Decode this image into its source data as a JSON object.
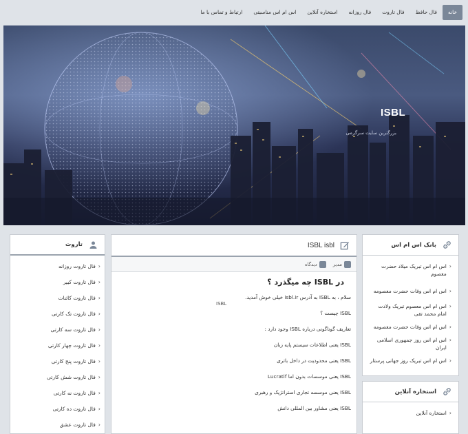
{
  "nav": {
    "items": [
      "خانه",
      "فال حافظ",
      "فال تاروت",
      "فال روزانه",
      "استخاره آنلاین",
      "اس ام اس مناسبتی",
      "ارتباط و تماس با ما"
    ]
  },
  "hero": {
    "title": "ISBL",
    "subtitle": "بزرگترین سایت سرگرمی"
  },
  "right_widget": {
    "title": "بانک اس ام اس",
    "items": [
      "اس ام اس تبریک میلاد حضرت معصوم",
      "اس ام اس وفات حضرت معصومه",
      "اس ام اس معصوم تبریک ولادت امام محمد تقی",
      "اس ام اس وفات حضرت معصومه",
      "اس ام اس روز جمهوری اسلامی ایران",
      "اس ام اس تبریک روز جهانی پرستار"
    ]
  },
  "right_widget2": {
    "title": "استخاره آنلاین",
    "items": [
      "استخاره آنلاین"
    ]
  },
  "left_widget": {
    "title": "تاروت",
    "items": [
      "فال تاروت روزانه",
      "فال تاروت کبیر",
      "فال تاروت کائنات",
      "فال تاروت تک کارتی",
      "فال تاروت سه کارتی",
      "فال تاروت چهار کارتی",
      "فال تاروت پنج کارتی",
      "فال تاروت شش کارتی",
      "فال تاروت نه کارتی",
      "فال تاروت ده کارتی",
      "فال تاروت عشق"
    ]
  },
  "post": {
    "header": "ISBL isbl",
    "meta_author": "مدیر",
    "meta_category": "دیدگاه",
    "title": "در ISBL چه میگذرد ؟",
    "side_tag": "ISBL",
    "paragraphs": [
      "سلام ، به ISBL به آدرس isbl.ir خیلی خوش آمدید.",
      "ISBL چیست ؟",
      "تعاریف گوناگونی درباره ISBL وجود دارد :",
      "ISBL یعنی اطلاعات سیستم پایه زبان",
      "ISBL یعنی محدودیت در داخل باتری",
      "ISBL یعنی موسسات بدون اما Lucratif",
      "ISBL یعنی موسسه تجاری استراتژیک و رهبری",
      "ISBL یعنی مشاور بین المللی دانش"
    ]
  }
}
